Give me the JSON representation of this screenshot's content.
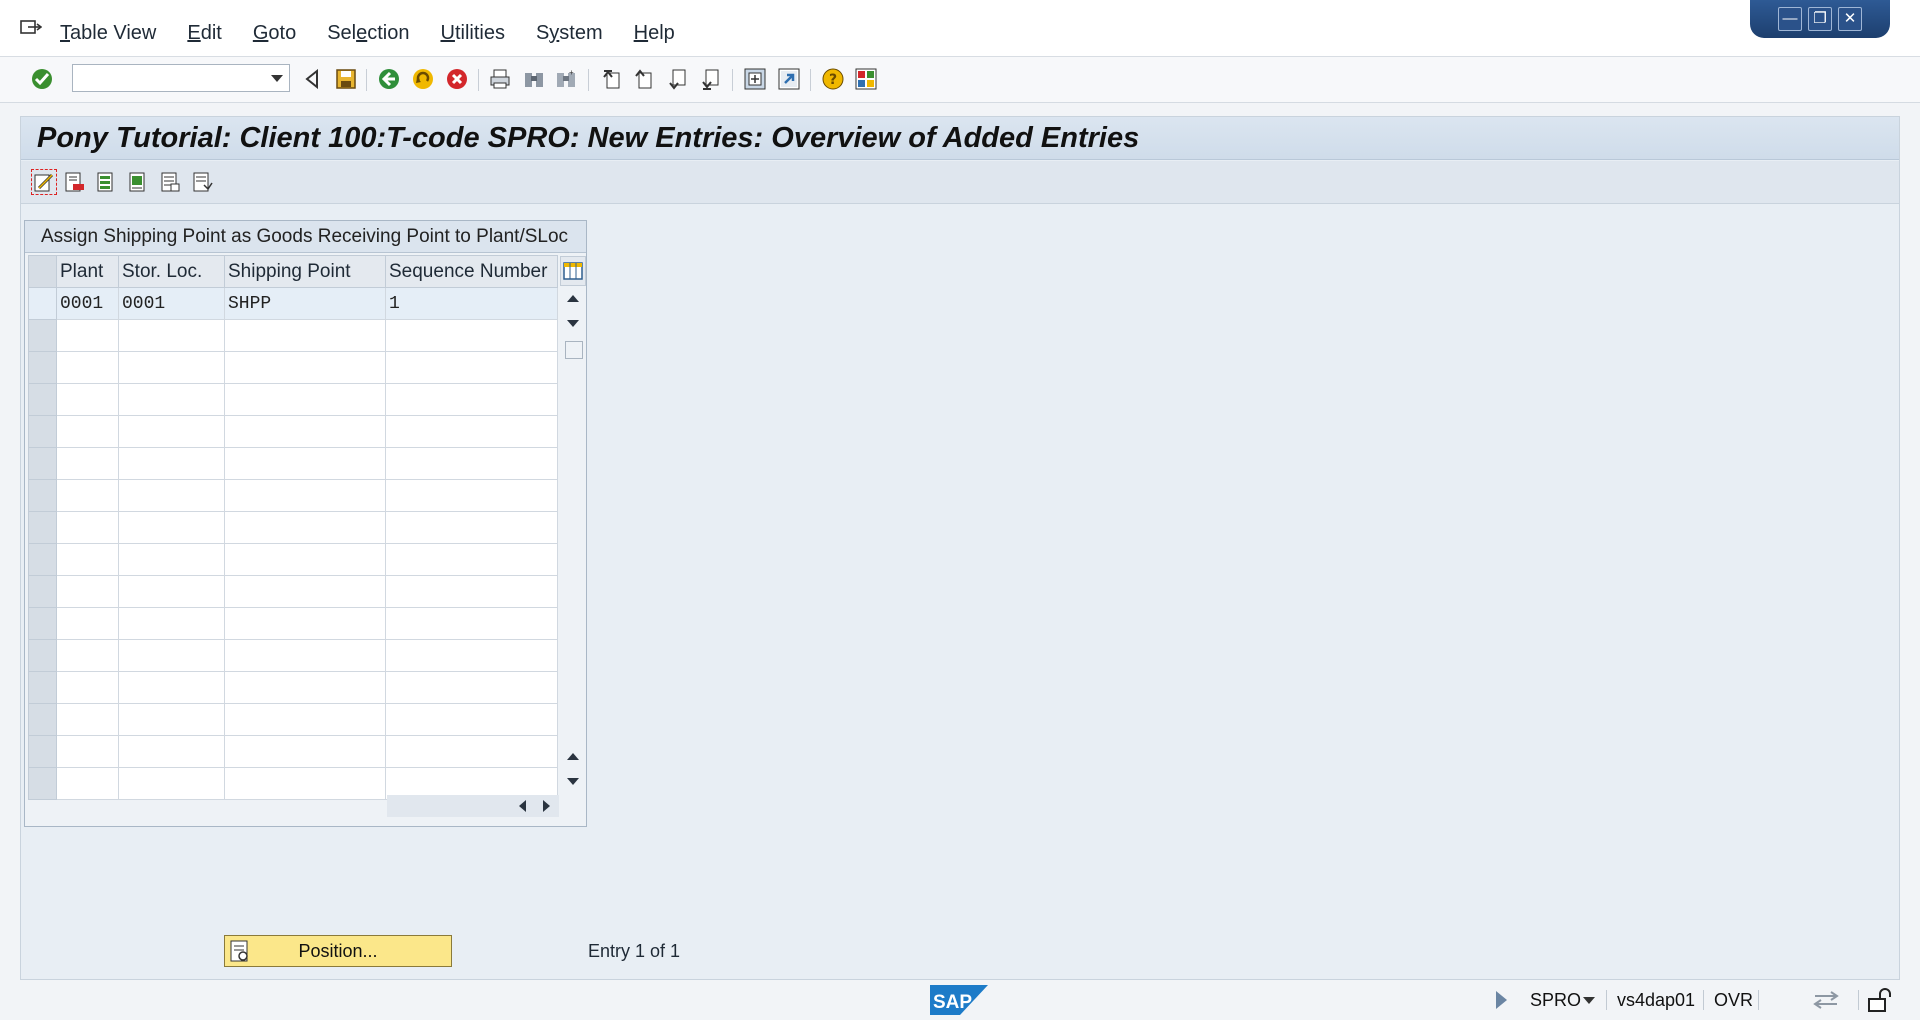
{
  "menu": {
    "items": [
      {
        "label": "Table View",
        "underline_index": 0
      },
      {
        "label": "Edit",
        "underline_index": 0
      },
      {
        "label": "Goto",
        "underline_index": 0
      },
      {
        "label": "Selection",
        "underline_index": 3
      },
      {
        "label": "Utilities",
        "underline_index": 0
      },
      {
        "label": "System",
        "underline_index": 1
      },
      {
        "label": "Help",
        "underline_index": 0
      }
    ]
  },
  "toolbar": {
    "command_field_value": ""
  },
  "window": {
    "title": "Pony Tutorial: Client 100:T-code SPRO: New Entries: Overview of Added Entries"
  },
  "table": {
    "title": "Assign Shipping Point as Goods Receiving Point to Plant/SLoc",
    "columns": [
      "Plant",
      "Stor. Loc.",
      "Shipping Point",
      "Sequence Number"
    ],
    "rows": [
      [
        "0001",
        "0001",
        "SHPP",
        "1"
      ],
      [
        "",
        "",
        "",
        ""
      ],
      [
        "",
        "",
        "",
        ""
      ],
      [
        "",
        "",
        "",
        ""
      ],
      [
        "",
        "",
        "",
        ""
      ],
      [
        "",
        "",
        "",
        ""
      ],
      [
        "",
        "",
        "",
        ""
      ],
      [
        "",
        "",
        "",
        ""
      ],
      [
        "",
        "",
        "",
        ""
      ],
      [
        "",
        "",
        "",
        ""
      ],
      [
        "",
        "",
        "",
        ""
      ],
      [
        "",
        "",
        "",
        ""
      ],
      [
        "",
        "",
        "",
        ""
      ],
      [
        "",
        "",
        "",
        ""
      ],
      [
        "",
        "",
        "",
        ""
      ],
      [
        "",
        "",
        "",
        ""
      ]
    ]
  },
  "footer": {
    "position_button_label": "Position...",
    "entry_text": "Entry 1 of 1"
  },
  "status": {
    "logo_text": "SAP",
    "transaction": "SPRO",
    "server": "vs4dap01",
    "mode": "OVR"
  },
  "colors": {
    "title_bg": "#cfdcea",
    "position_button_bg": "#fbe78a",
    "window_controls_bg": "#1d3f6e"
  },
  "icons": [
    "menu-icon",
    "check-icon",
    "back-icon",
    "save-icon",
    "nav-back-icon",
    "exit-icon",
    "cancel-icon",
    "print-icon",
    "find-icon",
    "find-next-icon",
    "first-page-icon",
    "previous-page-icon",
    "next-page-icon",
    "last-page-icon",
    "create-session-icon",
    "shortcut-icon",
    "help-icon",
    "layout-icon",
    "edit-pencil-icon",
    "column-settings-icon",
    "sap-logo"
  ]
}
